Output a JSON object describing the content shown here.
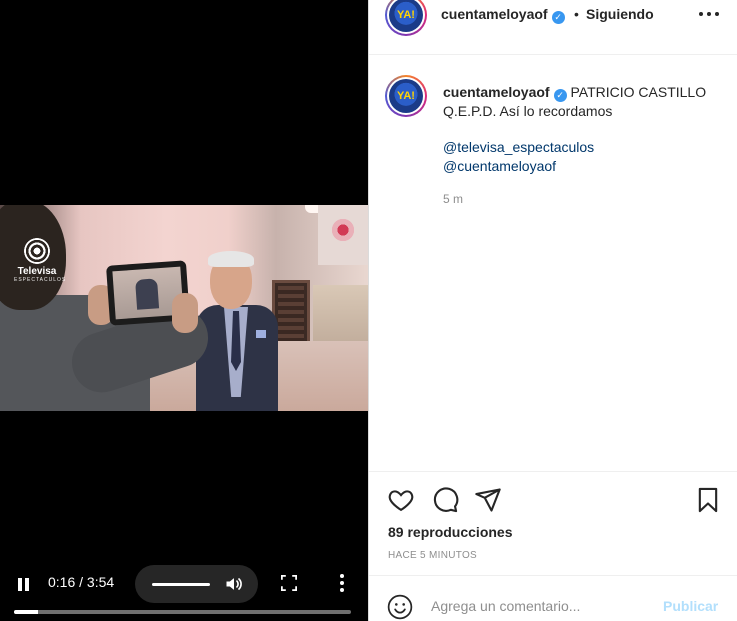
{
  "video": {
    "channel_logo_name": "Televisa",
    "channel_logo_sub": "ESPECTACULOS",
    "time": "0:16 / 3:54",
    "progress": 0.07,
    "icons": {
      "play_pause": "pause-icon",
      "volume": "volume-icon",
      "fullscreen": "fullscreen-icon",
      "more": "more-vertical-icon"
    }
  },
  "header": {
    "avatar_text": "YA!",
    "username": "cuentameloyaof",
    "verified": "✓",
    "separator": "•",
    "following": "Siguiendo",
    "menu_icon": "more-horizontal-icon"
  },
  "caption": {
    "avatar_text": "YA!",
    "username": "cuentameloyaof",
    "verified": "✓",
    "text": " PATRICIO CASTILLO Q.E.P.D. Así lo recordamos",
    "tags": [
      "@televisa_espectaculos",
      "@cuentameloyaof"
    ],
    "time_ago": "5 m"
  },
  "actions": {
    "icons": [
      "heart-icon",
      "comment-icon",
      "share-icon",
      "bookmark-icon"
    ],
    "views": "89 reproducciones",
    "posted": "HACE 5 MINUTOS"
  },
  "comment": {
    "placeholder": "Agrega un comentario...",
    "publish": "Publicar",
    "emoji_icon": "emoji-icon"
  },
  "colors": {
    "link": "#00376b",
    "verified": "#3897f0",
    "publish_disabled": "#b2dffc",
    "muted": "#8e8e8e"
  }
}
